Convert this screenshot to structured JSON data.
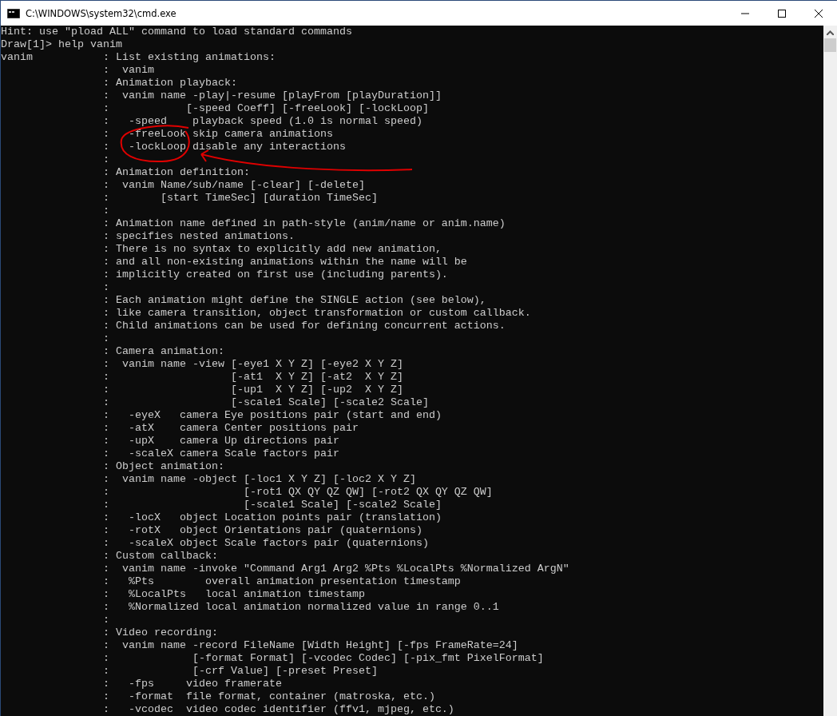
{
  "window": {
    "title": "C:\\WINDOWS\\system32\\cmd.exe"
  },
  "console": {
    "lines": [
      "Hint: use \"pload ALL\" command to load standard commands",
      "Draw[1]> help vanim",
      "vanim           : List existing animations:",
      "                :  vanim",
      "                : Animation playback:",
      "                :  vanim name -play|-resume [playFrom [playDuration]]",
      "                :            [-speed Coeff] [-freeLook] [-lockLoop]",
      "                :   -speed    playback speed (1.0 is normal speed)",
      "                :   -freeLook skip camera animations",
      "                :   -lockLoop disable any interactions",
      "                :",
      "                : Animation definition:",
      "                :  vanim Name/sub/name [-clear] [-delete]",
      "                :        [start TimeSec] [duration TimeSec]",
      "                :",
      "                : Animation name defined in path-style (anim/name or anim.name)",
      "                : specifies nested animations.",
      "                : There is no syntax to explicitly add new animation,",
      "                : and all non-existing animations within the name will be",
      "                : implicitly created on first use (including parents).",
      "                :",
      "                : Each animation might define the SINGLE action (see below),",
      "                : like camera transition, object transformation or custom callback.",
      "                : Child animations can be used for defining concurrent actions.",
      "                :",
      "                : Camera animation:",
      "                :  vanim name -view [-eye1 X Y Z] [-eye2 X Y Z]",
      "                :                   [-at1  X Y Z] [-at2  X Y Z]",
      "                :                   [-up1  X Y Z] [-up2  X Y Z]",
      "                :                   [-scale1 Scale] [-scale2 Scale]",
      "                :   -eyeX   camera Eye positions pair (start and end)",
      "                :   -atX    camera Center positions pair",
      "                :   -upX    camera Up directions pair",
      "                :   -scaleX camera Scale factors pair",
      "                : Object animation:",
      "                :  vanim name -object [-loc1 X Y Z] [-loc2 X Y Z]",
      "                :                     [-rot1 QX QY QZ QW] [-rot2 QX QY QZ QW]",
      "                :                     [-scale1 Scale] [-scale2 Scale]",
      "                :   -locX   object Location points pair (translation)",
      "                :   -rotX   object Orientations pair (quaternions)",
      "                :   -scaleX object Scale factors pair (quaternions)",
      "                : Custom callback:",
      "                :  vanim name -invoke \"Command Arg1 Arg2 %Pts %LocalPts %Normalized ArgN\"",
      "                :   %Pts        overall animation presentation timestamp",
      "                :   %LocalPts   local animation timestamp",
      "                :   %Normalized local animation normalized value in range 0..1",
      "                :",
      "                : Video recording:",
      "                :  vanim name -record FileName [Width Height] [-fps FrameRate=24]",
      "                :             [-format Format] [-vcodec Codec] [-pix_fmt PixelFormat]",
      "                :             [-crf Value] [-preset Preset]",
      "                :   -fps     video framerate",
      "                :   -format  file format, container (matroska, etc.)",
      "                :   -vcodec  video codec identifier (ffv1, mjpeg, etc.)"
    ]
  }
}
